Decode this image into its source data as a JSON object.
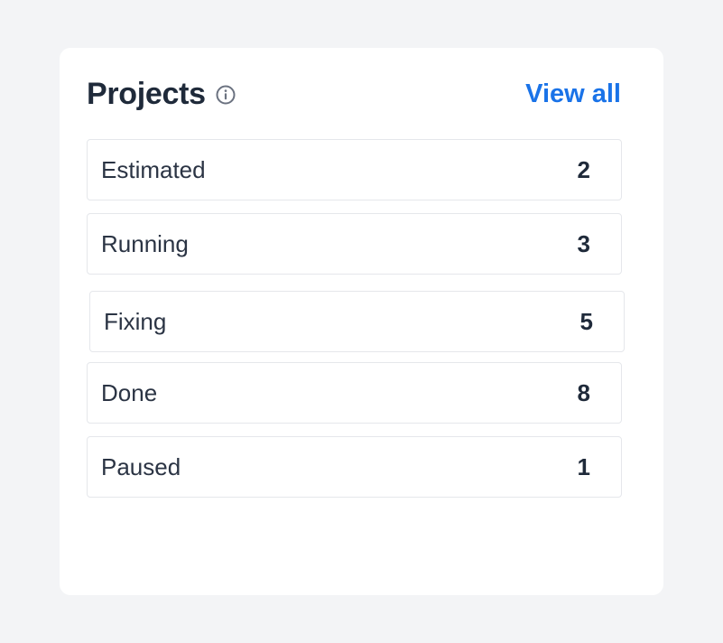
{
  "card": {
    "title": "Projects",
    "info_icon": "info-circle-icon",
    "view_all_label": "View all"
  },
  "statuses": [
    {
      "label": "Estimated",
      "count": "2"
    },
    {
      "label": "Running",
      "count": "3"
    },
    {
      "label": "Fixing",
      "count": "5"
    },
    {
      "label": "Done",
      "count": "8"
    },
    {
      "label": "Paused",
      "count": "1"
    }
  ],
  "colors": {
    "page_background": "#f3f4f6",
    "card_background": "#ffffff",
    "title": "#1f2a3a",
    "link": "#1a73e8",
    "row_border": "#e5e7eb"
  }
}
